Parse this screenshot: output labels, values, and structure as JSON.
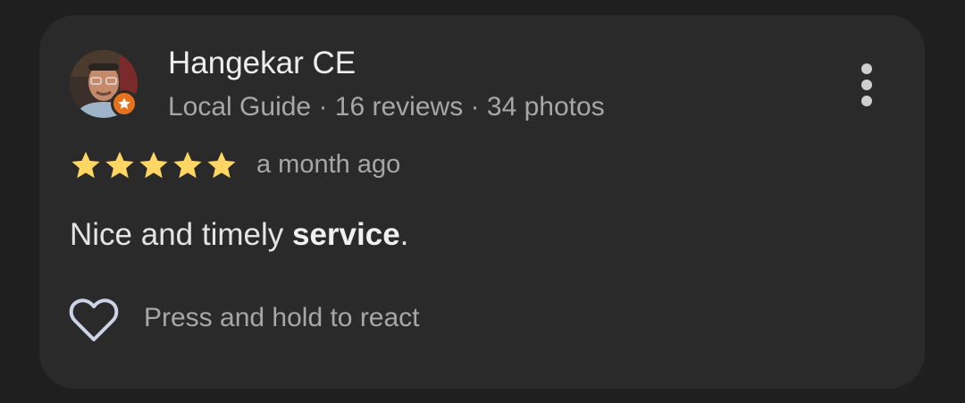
{
  "reviewer": {
    "name": "Hangekar CE",
    "level": "Local Guide",
    "separator": "·",
    "reviews": "16 reviews",
    "photos": "34 photos",
    "avatar_icon": "profile-photo",
    "badge_icon": "local-guide-star-icon"
  },
  "rating": {
    "stars": 5,
    "max_stars": 5,
    "star_color": "#fdd663",
    "time": "a month ago"
  },
  "review": {
    "text_before": "Nice and timely ",
    "text_bold": "service",
    "text_after": "."
  },
  "react": {
    "icon": "heart-outline-icon",
    "label": "Press and hold to react"
  },
  "menu": {
    "icon": "more-vertical-icon"
  },
  "colors": {
    "background": "#1f1f1f",
    "card": "#2a2a2a",
    "badge": "#e8711c"
  }
}
